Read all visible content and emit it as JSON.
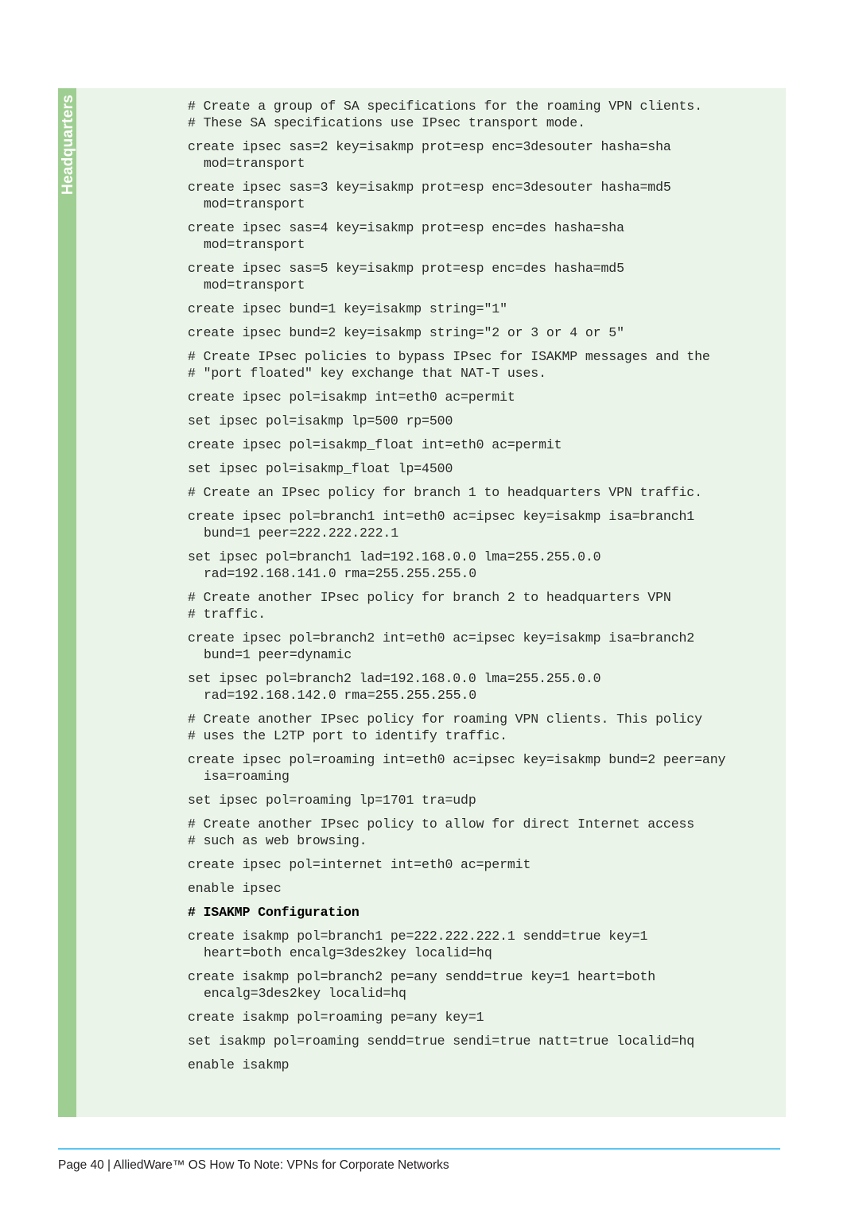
{
  "panel": {
    "side_tab_label": "Headquarters"
  },
  "code_blocks": [
    {
      "lines": [
        {
          "text": "# Create a group of SA specifications for the roaming VPN clients.",
          "cont": false,
          "heading": false
        },
        {
          "text": "# These SA specifications use IPsec transport mode.",
          "cont": false,
          "heading": false
        }
      ]
    },
    {
      "lines": [
        {
          "text": "create ipsec sas=2 key=isakmp prot=esp enc=3desouter hasha=sha",
          "cont": false,
          "heading": false
        },
        {
          "text": "mod=transport",
          "cont": true,
          "heading": false
        }
      ]
    },
    {
      "lines": [
        {
          "text": "create ipsec sas=3 key=isakmp prot=esp enc=3desouter hasha=md5",
          "cont": false,
          "heading": false
        },
        {
          "text": "mod=transport",
          "cont": true,
          "heading": false
        }
      ]
    },
    {
      "lines": [
        {
          "text": "create ipsec sas=4 key=isakmp prot=esp enc=des hasha=sha",
          "cont": false,
          "heading": false
        },
        {
          "text": "mod=transport",
          "cont": true,
          "heading": false
        }
      ]
    },
    {
      "lines": [
        {
          "text": "create ipsec sas=5 key=isakmp prot=esp enc=des hasha=md5",
          "cont": false,
          "heading": false
        },
        {
          "text": "mod=transport",
          "cont": true,
          "heading": false
        }
      ]
    },
    {
      "lines": [
        {
          "text": "create ipsec bund=1 key=isakmp string=\"1\"",
          "cont": false,
          "heading": false
        }
      ]
    },
    {
      "lines": [
        {
          "text": "create ipsec bund=2 key=isakmp string=\"2 or 3 or 4 or 5\"",
          "cont": false,
          "heading": false
        }
      ]
    },
    {
      "lines": [
        {
          "text": "# Create IPsec policies to bypass IPsec for ISAKMP messages and the",
          "cont": false,
          "heading": false
        },
        {
          "text": "# \"port floated\" key exchange that NAT-T uses.",
          "cont": false,
          "heading": false
        }
      ]
    },
    {
      "lines": [
        {
          "text": "create ipsec pol=isakmp int=eth0 ac=permit",
          "cont": false,
          "heading": false
        }
      ]
    },
    {
      "lines": [
        {
          "text": "set ipsec pol=isakmp lp=500 rp=500",
          "cont": false,
          "heading": false
        }
      ]
    },
    {
      "lines": [
        {
          "text": "create ipsec pol=isakmp_float int=eth0 ac=permit",
          "cont": false,
          "heading": false
        }
      ]
    },
    {
      "lines": [
        {
          "text": "set ipsec pol=isakmp_float lp=4500",
          "cont": false,
          "heading": false
        }
      ]
    },
    {
      "lines": [
        {
          "text": "# Create an IPsec policy for branch 1 to headquarters VPN traffic.",
          "cont": false,
          "heading": false
        }
      ]
    },
    {
      "lines": [
        {
          "text": "create ipsec pol=branch1 int=eth0 ac=ipsec key=isakmp isa=branch1",
          "cont": false,
          "heading": false
        },
        {
          "text": "bund=1 peer=222.222.222.1",
          "cont": true,
          "heading": false
        }
      ]
    },
    {
      "lines": [
        {
          "text": "set ipsec pol=branch1 lad=192.168.0.0 lma=255.255.0.0",
          "cont": false,
          "heading": false
        },
        {
          "text": "rad=192.168.141.0 rma=255.255.255.0",
          "cont": true,
          "heading": false
        }
      ]
    },
    {
      "lines": [
        {
          "text": "# Create another IPsec policy for branch 2 to headquarters VPN",
          "cont": false,
          "heading": false
        },
        {
          "text": "# traffic.",
          "cont": false,
          "heading": false
        }
      ]
    },
    {
      "lines": [
        {
          "text": "create ipsec pol=branch2 int=eth0 ac=ipsec key=isakmp isa=branch2",
          "cont": false,
          "heading": false
        },
        {
          "text": "bund=1 peer=dynamic",
          "cont": true,
          "heading": false
        }
      ]
    },
    {
      "lines": [
        {
          "text": "set ipsec pol=branch2 lad=192.168.0.0 lma=255.255.0.0",
          "cont": false,
          "heading": false
        },
        {
          "text": "rad=192.168.142.0 rma=255.255.255.0",
          "cont": true,
          "heading": false
        }
      ]
    },
    {
      "lines": [
        {
          "text": "# Create another IPsec policy for roaming VPN clients. This policy",
          "cont": false,
          "heading": false
        },
        {
          "text": "# uses the L2TP port to identify traffic.",
          "cont": false,
          "heading": false
        }
      ]
    },
    {
      "lines": [
        {
          "text": "create ipsec pol=roaming int=eth0 ac=ipsec key=isakmp bund=2 peer=any",
          "cont": false,
          "heading": false
        },
        {
          "text": "isa=roaming",
          "cont": true,
          "heading": false
        }
      ]
    },
    {
      "lines": [
        {
          "text": "set ipsec pol=roaming lp=1701 tra=udp",
          "cont": false,
          "heading": false
        }
      ]
    },
    {
      "lines": [
        {
          "text": "# Create another IPsec policy to allow for direct Internet access",
          "cont": false,
          "heading": false
        },
        {
          "text": "# such as web browsing.",
          "cont": false,
          "heading": false
        }
      ]
    },
    {
      "lines": [
        {
          "text": "create ipsec pol=internet int=eth0 ac=permit",
          "cont": false,
          "heading": false
        }
      ]
    },
    {
      "lines": [
        {
          "text": "enable ipsec",
          "cont": false,
          "heading": false
        }
      ]
    },
    {
      "lines": [
        {
          "text": "# ISAKMP Configuration",
          "cont": false,
          "heading": true
        }
      ]
    },
    {
      "lines": [
        {
          "text": "create isakmp pol=branch1 pe=222.222.222.1 sendd=true key=1",
          "cont": false,
          "heading": false
        },
        {
          "text": "heart=both encalg=3des2key localid=hq",
          "cont": true,
          "heading": false
        }
      ]
    },
    {
      "lines": [
        {
          "text": "create isakmp pol=branch2 pe=any sendd=true key=1 heart=both",
          "cont": false,
          "heading": false
        },
        {
          "text": "encalg=3des2key localid=hq",
          "cont": true,
          "heading": false
        }
      ]
    },
    {
      "lines": [
        {
          "text": "create isakmp pol=roaming pe=any key=1",
          "cont": false,
          "heading": false
        }
      ]
    },
    {
      "lines": [
        {
          "text": "set isakmp pol=roaming sendd=true sendi=true natt=true localid=hq",
          "cont": false,
          "heading": false
        }
      ]
    },
    {
      "lines": [
        {
          "text": "enable isakmp",
          "cont": false,
          "heading": false
        }
      ]
    }
  ],
  "footer": {
    "text": "Page 40 | AlliedWare™ OS How To Note: VPNs for Corporate Networks",
    "page_number": "40",
    "rule_color": "#5bc6f0"
  },
  "colors": {
    "panel_background": "#eaf4e8",
    "side_tab": "#9fce92",
    "code_text": "#2b2b2b",
    "page_background": "#ffffff"
  }
}
